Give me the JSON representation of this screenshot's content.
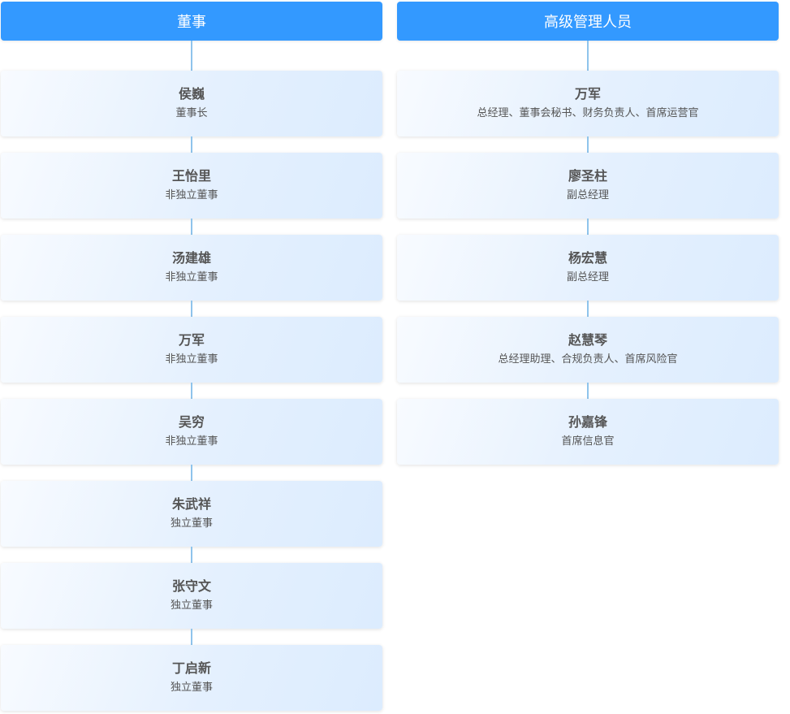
{
  "board": {
    "header": "董事",
    "members": [
      {
        "name": "侯巍",
        "title": "董事长"
      },
      {
        "name": "王怡里",
        "title": "非独立董事"
      },
      {
        "name": "汤建雄",
        "title": "非独立董事"
      },
      {
        "name": "万军",
        "title": "非独立董事"
      },
      {
        "name": "吴穷",
        "title": "非独立董事"
      },
      {
        "name": "朱武祥",
        "title": "独立董事"
      },
      {
        "name": "张守文",
        "title": "独立董事"
      },
      {
        "name": "丁启新",
        "title": "独立董事"
      }
    ]
  },
  "management": {
    "header": "高级管理人员",
    "members": [
      {
        "name": "万军",
        "title": "总经理、董事会秘书、财务负责人、首席运营官"
      },
      {
        "name": "廖圣柱",
        "title": "副总经理"
      },
      {
        "name": "杨宏慧",
        "title": "副总经理"
      },
      {
        "name": "赵慧琴",
        "title": "总经理助理、合规负责人、首席风险官"
      },
      {
        "name": "孙嘉锋",
        "title": "首席信息官"
      }
    ]
  },
  "colors": {
    "header_bg": "#3399ff",
    "connector": "#8fc4ec",
    "card_gradient_start": "#f8fbff",
    "card_gradient_end": "#dcecfe",
    "text": "#555555"
  }
}
